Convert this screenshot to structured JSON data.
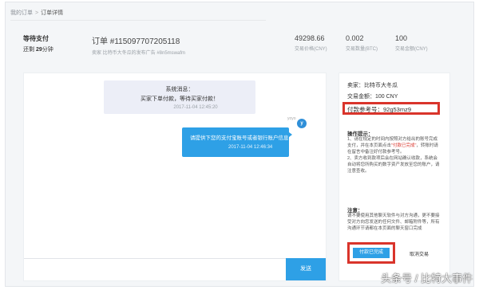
{
  "breadcrumb": {
    "home": "我的订单",
    "separator": ">",
    "current": "订单详情"
  },
  "summary": {
    "status": "等待支付",
    "time_prefix": "还剩",
    "time_value": "29",
    "time_suffix": "分钟",
    "order_no": "订单 #115097707205118",
    "order_desc": "卖家 比特币大冬瓜的发布广告 #8n5mswafm",
    "price": {
      "value": "49298.66",
      "label": "交易价格(CNY)"
    },
    "btc": {
      "value": "0.002",
      "label": "交易数量(BTC)"
    },
    "total": {
      "value": "100",
      "label": "交易金额(CNY)"
    }
  },
  "chat": {
    "system": {
      "title": "系统消息：",
      "text": "买家下单付款，等待买家付款！",
      "time": "2017-11-04 12:45:20"
    },
    "user": {
      "name": "yoyo",
      "avatar": "y",
      "text": "请提供下您的支付宝账号或者银行账户信息",
      "time": "2017-11-04 12:46:34"
    },
    "input_placeholder": "",
    "send_label": "发送"
  },
  "info": {
    "seller": "卖家：比特币大冬瓜",
    "amount": "交易金额：100 CNY",
    "ref": "付款参考号：92g53mz9",
    "tips_title": "操作提示：",
    "tips_1": "1、请在规定的时间内按照对方给出的账号完成支付，并在本页面点击",
    "tips_highlight": "\"付款已完成\"",
    "tips_2": "，转账时请在留言中备注好付款参考号。",
    "tips_3": "2、卖方收到款项后会在网站确认收款，系统会自动将您所购买的数字资产发放至您的账户，请注意查收。",
    "note_title": "注意：",
    "note_text": "请不要使用其他聊天软件与对方沟通，更不要接受对方向您发送的任何文件、邮箱附件等，所有沟通环节请都在本页面的聊天窗口完成",
    "paid_label": "付款已完成",
    "cancel_label": "取消交易"
  },
  "watermark": "头条号 / 比特大事件",
  "colors": {
    "accent": "#2ea0e6",
    "highlight_border": "#d9342b"
  }
}
